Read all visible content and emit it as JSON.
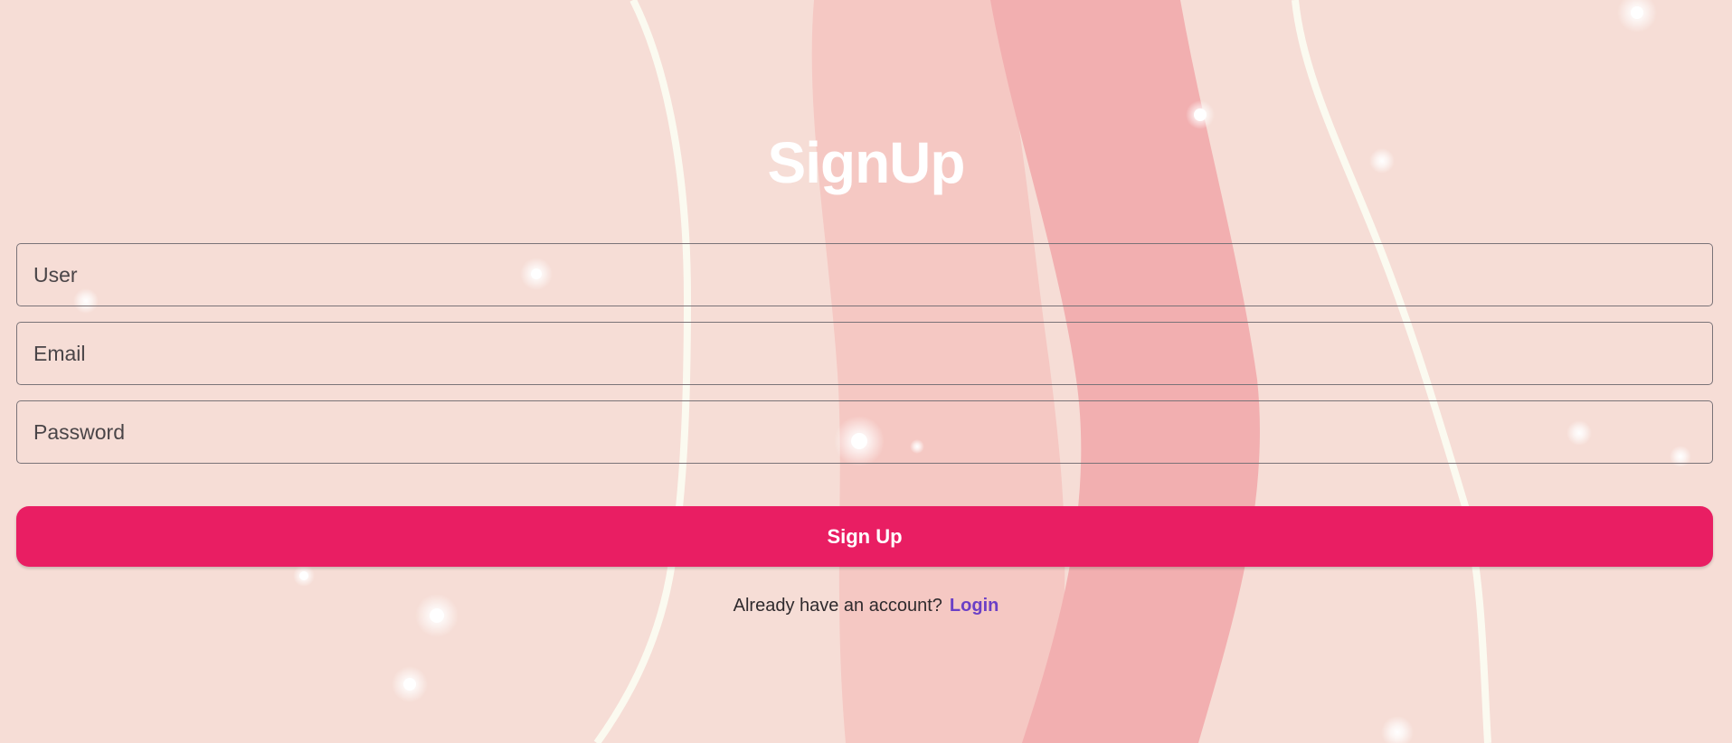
{
  "colors": {
    "background": "#f6ddd6",
    "primary_button": "#e91e63",
    "link": "#6a3fc6",
    "title": "#ffffff"
  },
  "form": {
    "title": "SignUp",
    "user_placeholder": "User",
    "email_placeholder": "Email",
    "password_placeholder": "Password",
    "submit_label": "Sign Up"
  },
  "footer": {
    "prompt": "Already have an account?",
    "login_label": "Login"
  }
}
